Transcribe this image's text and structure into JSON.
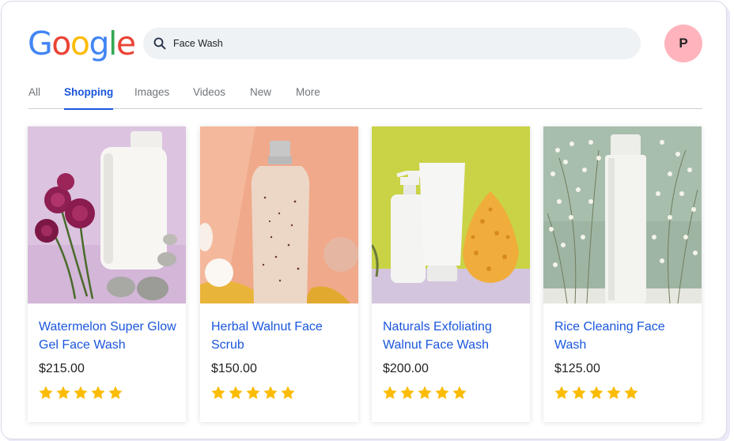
{
  "logo": {
    "letters": [
      "G",
      "o",
      "o",
      "g",
      "l",
      "e"
    ],
    "colors": [
      "#4285F4",
      "#EA4335",
      "#FBBC05",
      "#4285F4",
      "#34A853",
      "#EA4335"
    ]
  },
  "search": {
    "query": "Face Wash",
    "icon": "search-icon"
  },
  "profile": {
    "initial": "P",
    "color": "#ffb4bd"
  },
  "tabs": [
    {
      "label": "All",
      "active": false
    },
    {
      "label": "Shopping",
      "active": true
    },
    {
      "label": "Images",
      "active": false
    },
    {
      "label": "Videos",
      "active": false
    },
    {
      "label": "New",
      "active": false
    },
    {
      "label": "More",
      "active": false
    }
  ],
  "products": [
    {
      "title": "Watermelon Super Glow Gel Face Wash",
      "price": "$215.00",
      "rating": 5,
      "image": "white bottle with pink flowers on lilac background"
    },
    {
      "title": "Herbal Walnut Face Scrub",
      "price": "$150.00",
      "rating": 5,
      "image": "scrub bottle on peach background"
    },
    {
      "title": "Naturals Exfoliating Walnut Face Wash",
      "price": "$200.00",
      "rating": 5,
      "image": "pump bottle, tube and sponge on lime background"
    },
    {
      "title": "Rice Cleaning Face Wash",
      "price": "$125.00",
      "rating": 5,
      "image": "white bottle with baby's breath on sage background"
    }
  ],
  "colors": {
    "accent": "#1a56db",
    "star": "#FBBC05",
    "search_bg": "#eef2f4"
  }
}
